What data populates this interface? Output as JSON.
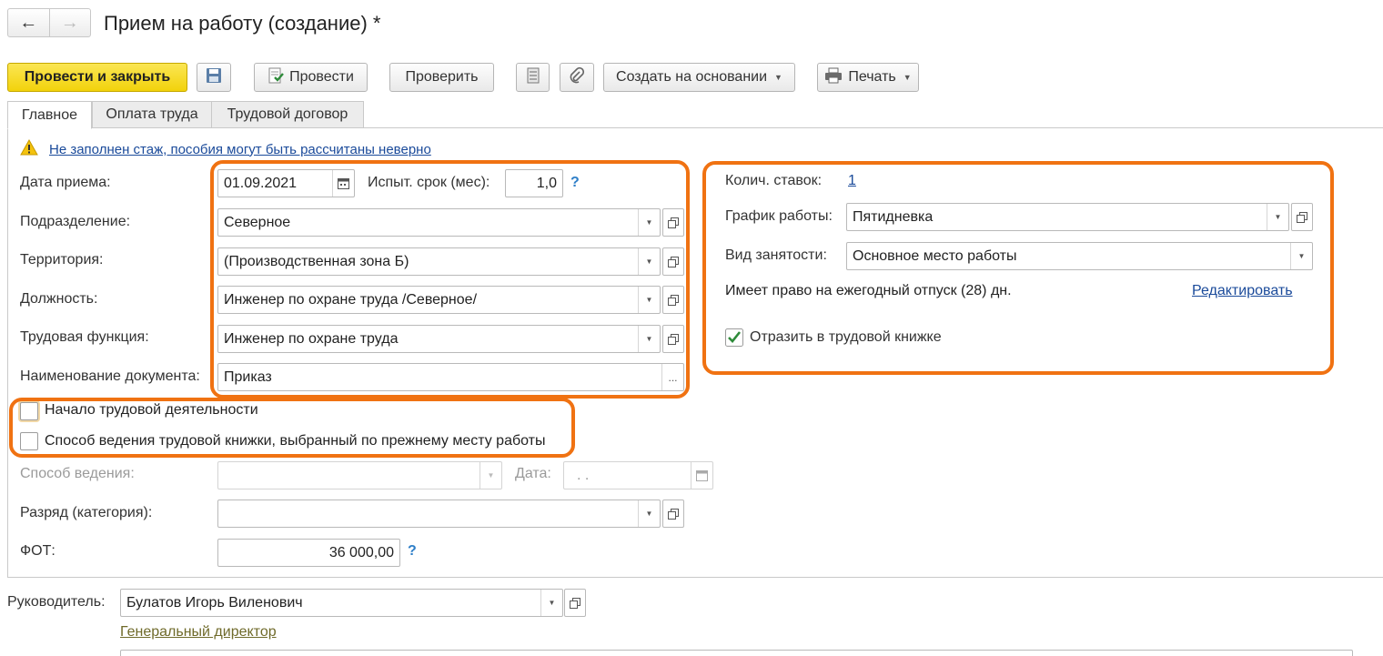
{
  "header": {
    "title": "Прием на работу (создание) *",
    "back_icon": "arrow-left-icon",
    "forward_icon": "arrow-right-icon"
  },
  "toolbar": {
    "post_close": "Провести и закрыть",
    "post": "Провести",
    "check": "Проверить",
    "create_based": "Создать на основании",
    "print": "Печать"
  },
  "tabs": [
    {
      "label": "Главное"
    },
    {
      "label": "Оплата труда"
    },
    {
      "label": "Трудовой договор"
    }
  ],
  "warning": {
    "text": "Не заполнен стаж, пособия могут быть рассчитаны неверно"
  },
  "form": {
    "hire_date": {
      "label": "Дата приема:",
      "value": "01.09.2021"
    },
    "probation": {
      "label": "Испыт. срок (мес):",
      "value": "1,0"
    },
    "department": {
      "label": "Подразделение:",
      "value": "Северное"
    },
    "territory": {
      "label": "Территория:",
      "value": "(Производственная зона Б)"
    },
    "position": {
      "label": "Должность:",
      "value": "Инженер по охране труда /Северное/"
    },
    "labor_function": {
      "label": "Трудовая функция:",
      "value": "Инженер по охране труда"
    },
    "doc_name": {
      "label": "Наименование документа:",
      "value": "Приказ"
    },
    "rates": {
      "label": "Колич. ставок:",
      "value": "1"
    },
    "schedule": {
      "label": "График работы:",
      "value": "Пятидневка"
    },
    "employment_type": {
      "label": "Вид занятости:",
      "value": "Основное место работы"
    },
    "vacation_text": "Имеет право на ежегодный отпуск (28) дн.",
    "edit_link": "Редактировать",
    "workbook_reflect": {
      "label": "Отразить в трудовой книжке",
      "checked": true
    },
    "career_start": {
      "label": "Начало трудовой деятельности",
      "checked": false
    },
    "workbook_method_prev": {
      "label": "Способ ведения трудовой книжки, выбранный по прежнему месту работы",
      "checked": false
    },
    "keeping_method": {
      "label": "Способ ведения:",
      "value": ""
    },
    "date": {
      "label": "Дата:",
      "value": " .  ."
    },
    "grade": {
      "label": "Разряд (категория):",
      "value": ""
    },
    "payroll": {
      "label": "ФОТ:",
      "value": "36 000,00"
    },
    "help": "?"
  },
  "manager": {
    "label": "Руководитель:",
    "value": "Булатов Игорь Виленович",
    "title_link": "Генеральный директор"
  },
  "colors": {
    "accent_yellow": "#f2d20b",
    "highlight_orange": "#f07212",
    "link_blue": "#1a4a9a",
    "check_green": "#2e8b3a"
  }
}
